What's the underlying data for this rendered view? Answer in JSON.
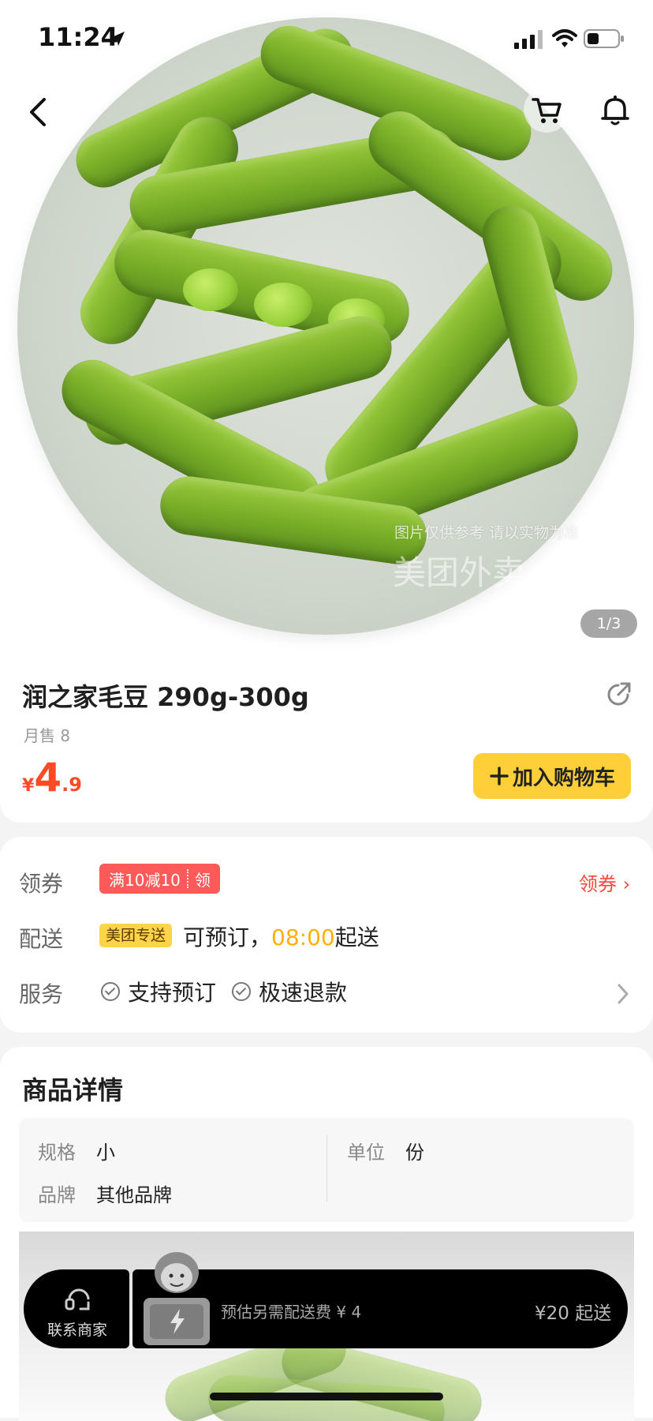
{
  "status_bar": {
    "time": "11:24"
  },
  "hero": {
    "watermark": "图片仅供参考 请以实物为准",
    "watermark_logo": "美团外卖",
    "page_indicator": "1/3"
  },
  "product": {
    "name": "润之家毛豆 290g-300g",
    "monthly_sales": "月售 8",
    "currency": "¥",
    "price_int": "4",
    "price_dec": ".9",
    "add_to_cart": "加入购物车"
  },
  "coupon": {
    "label": "领券",
    "badge_text": "满10减10",
    "badge_action": "领",
    "link": "领券 ›"
  },
  "delivery": {
    "label": "配送",
    "badge": "美团专送",
    "text_prefix": "可预订，",
    "time": "08:00",
    "text_suffix": "起送"
  },
  "service": {
    "label": "服务",
    "items": [
      "支持预订",
      "极速退款"
    ]
  },
  "details": {
    "title": "商品详情",
    "specs": [
      {
        "label": "规格",
        "value": "小"
      },
      {
        "label": "品牌",
        "value": "其他品牌"
      },
      {
        "label": "单位",
        "value": "份"
      }
    ]
  },
  "bottom_bar": {
    "contact_label": "联系商家",
    "delivery_fee": "预估另需配送费 ¥ 4",
    "min_order": "¥20 起送"
  },
  "colors": {
    "price": "#ff4a26",
    "add_cart_bg": "#ffcf3a",
    "coupon_badge": "#ff5a5a",
    "delivery_badge": "#ffd34a",
    "delivery_time": "#ffb000"
  }
}
